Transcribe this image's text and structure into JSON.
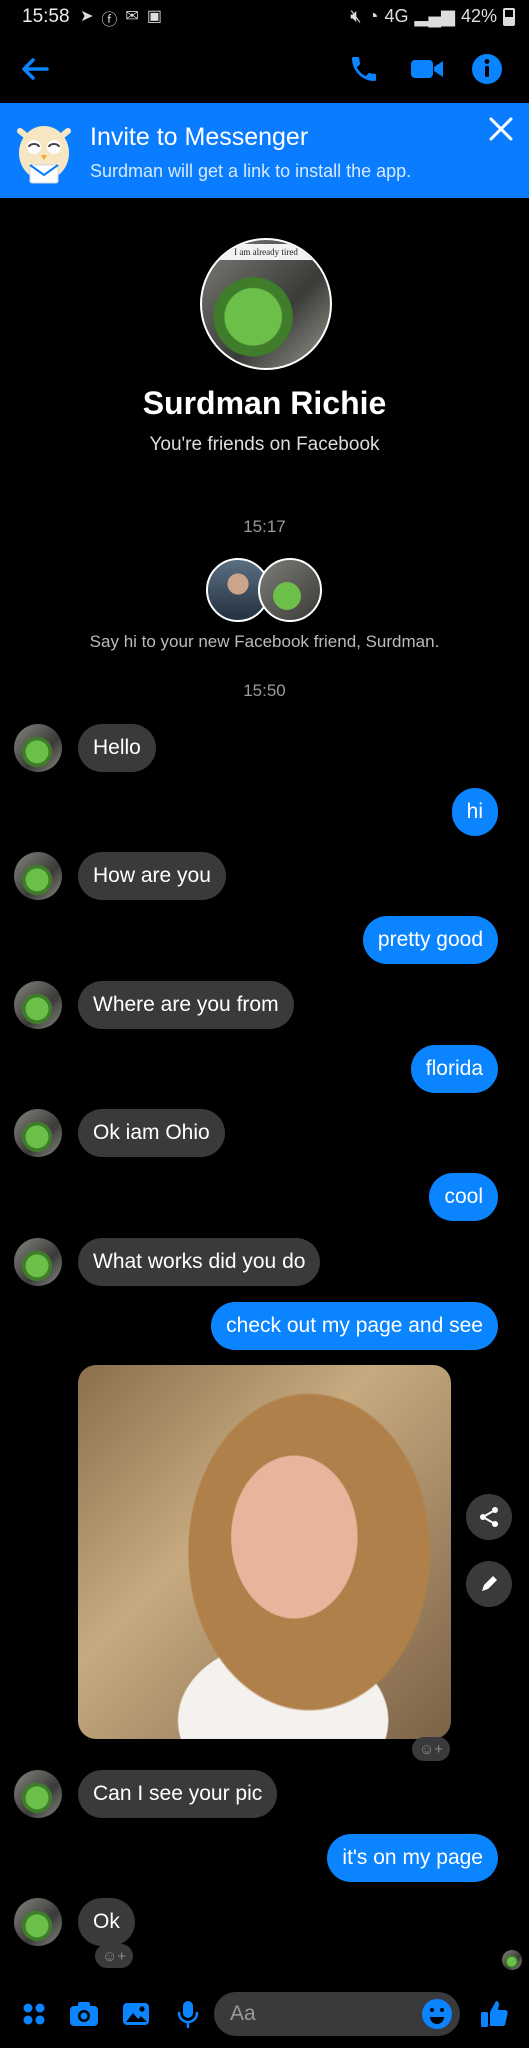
{
  "status": {
    "time": "15:58",
    "battery": "42%",
    "network": "4G"
  },
  "header": {},
  "invite": {
    "title": "Invite to Messenger",
    "subtitle": "Surdman will get a link to install the app."
  },
  "profile": {
    "name": "Surdman Richie",
    "relation": "You're friends on Facebook",
    "pic_caption": "I am already tired"
  },
  "timestamps": {
    "first": "15:17",
    "second": "15:50"
  },
  "say_hi": "Say hi to your new Facebook friend, Surdman.",
  "messages": [
    {
      "from": "them",
      "text": "Hello"
    },
    {
      "from": "me",
      "text": "hi"
    },
    {
      "from": "them",
      "text": "How are you"
    },
    {
      "from": "me",
      "text": "pretty good"
    },
    {
      "from": "them",
      "text": "Where are you from"
    },
    {
      "from": "me",
      "text": "florida"
    },
    {
      "from": "them",
      "text": "Ok iam Ohio"
    },
    {
      "from": "me",
      "text": "cool"
    },
    {
      "from": "them",
      "text": "What works did you do"
    },
    {
      "from": "me",
      "text": "check out my page and see"
    },
    {
      "from": "them",
      "text": "Can I see your pic"
    },
    {
      "from": "me",
      "text": "it's on my page"
    },
    {
      "from": "them",
      "text": "Ok"
    }
  ],
  "composer": {
    "placeholder": "Aa"
  },
  "colors": {
    "accent": "#0a84ff",
    "banner": "#0a7cff",
    "incoming": "#3a3a3c",
    "background": "#000000"
  }
}
